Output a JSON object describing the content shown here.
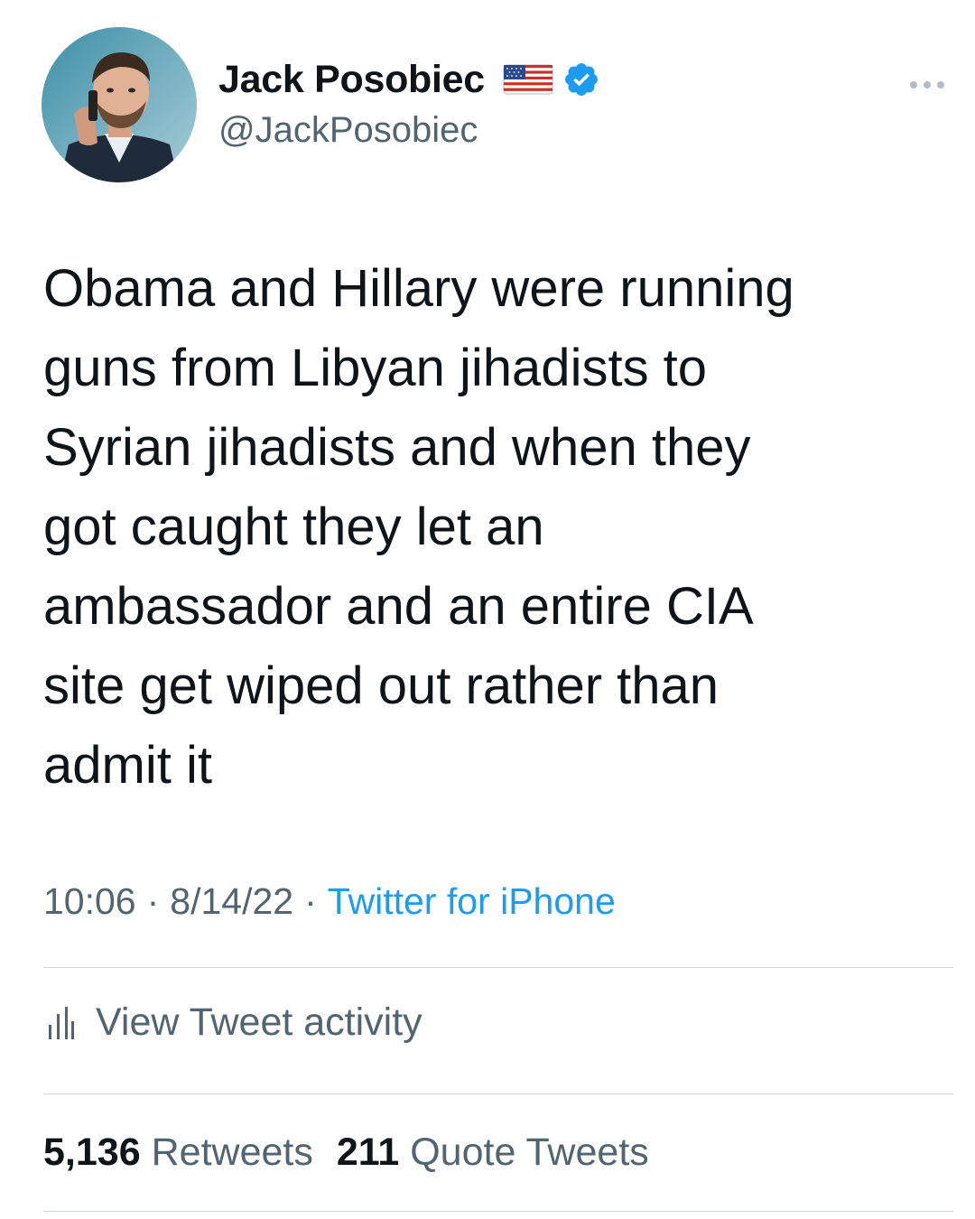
{
  "author": {
    "display_name": "Jack Posobiec",
    "handle": "@JackPosobiec",
    "avatar_icon": "profile-photo",
    "flag_icon": "us-flag-emoji",
    "verified_icon": "verified-badge-icon"
  },
  "tweet": {
    "text": "Obama and Hillary were running\nguns from Libyan jihadists to\nSyrian jihadists and when they\ngot caught they let an\nambassador and an entire CIA\nsite get wiped out rather than\nadmit it"
  },
  "meta": {
    "time": "10:06",
    "separator": "·",
    "date": "8/14/22",
    "source": "Twitter for iPhone"
  },
  "activity": {
    "label": "View Tweet activity"
  },
  "stats": {
    "retweets_count": "5,136",
    "retweets_label": "Retweets",
    "quotes_count": "211",
    "quotes_label": "Quote Tweets"
  },
  "colors": {
    "text_primary": "#0f1419",
    "text_secondary": "#536471",
    "accent": "#1d9bf0",
    "divider": "#cfd9de"
  }
}
